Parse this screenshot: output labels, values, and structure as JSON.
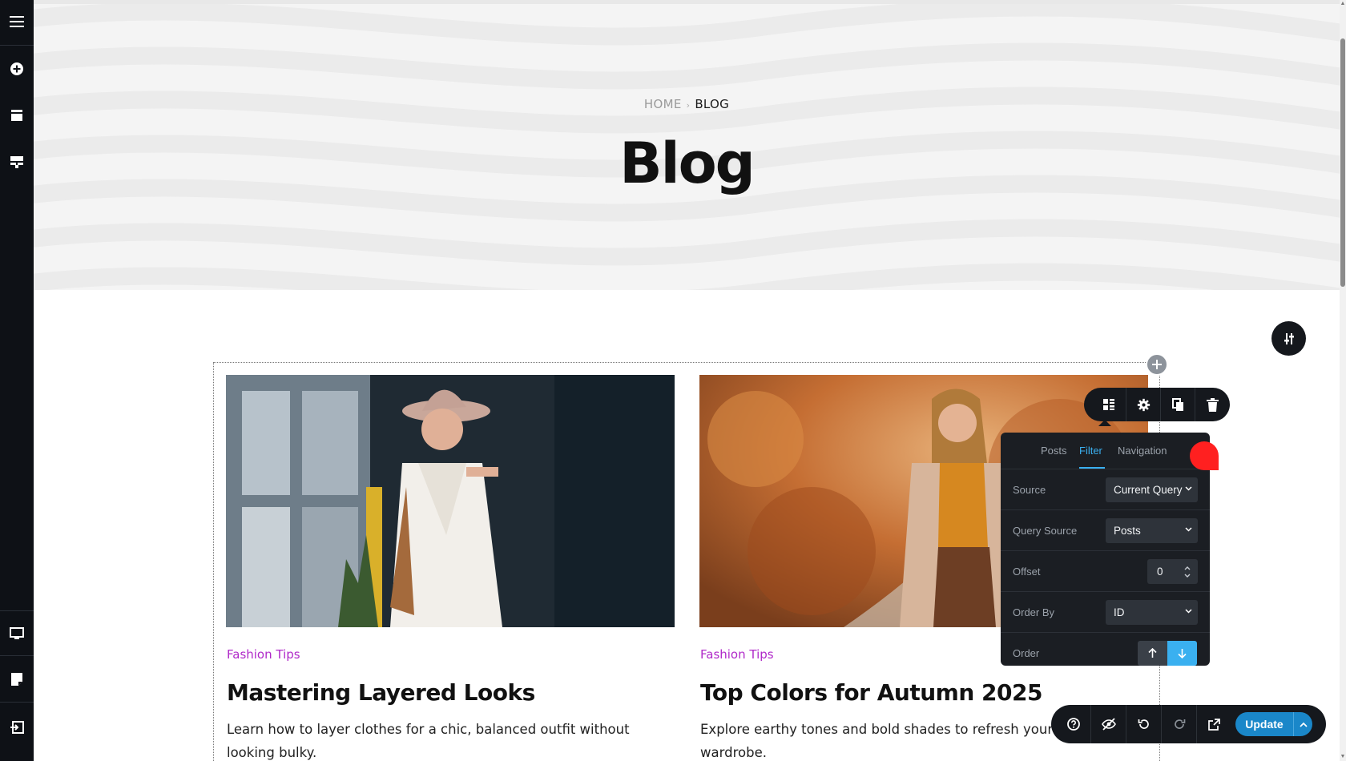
{
  "breadcrumb": {
    "home": "HOME",
    "separator": "›",
    "current": "BLOG"
  },
  "page": {
    "title": "Blog"
  },
  "left_sidebar": {
    "icons": [
      "menu-icon",
      "add-circle-icon",
      "layers-icon",
      "template-icon",
      "desktop-icon",
      "notes-icon",
      "exit-icon"
    ]
  },
  "posts": [
    {
      "category": "Fashion Tips",
      "title": "Mastering Layered Looks",
      "excerpt": "Learn how to layer clothes for a chic, balanced outfit without looking bulky."
    },
    {
      "category": "Fashion Tips",
      "title": "Top Colors for Autumn 2025",
      "excerpt": "Explore earthy tones and bold shades to refresh your autumn wardrobe."
    }
  ],
  "widget_toolbar": {
    "icons": [
      "layout-icon",
      "gear-icon",
      "duplicate-icon",
      "trash-icon"
    ]
  },
  "panel": {
    "tabs": [
      "Posts",
      "Filter",
      "Navigation"
    ],
    "active_tab": "Filter",
    "source": {
      "label": "Source",
      "value": "Current Query"
    },
    "query_source": {
      "label": "Query Source",
      "value": "Posts"
    },
    "offset": {
      "label": "Offset",
      "value": "0"
    },
    "order_by": {
      "label": "Order By",
      "value": "ID"
    },
    "order": {
      "label": "Order",
      "selected": "descending"
    }
  },
  "bottom_bar": {
    "icons": [
      "help-icon",
      "hide-icon",
      "undo-icon",
      "redo-icon",
      "external-link-icon"
    ],
    "update_label": "Update"
  },
  "colors": {
    "accent": "#1a87c9",
    "tab_active": "#3ab0f0",
    "category": "#b02ac9",
    "dark": "#15181d",
    "notification": "#ff2020"
  }
}
